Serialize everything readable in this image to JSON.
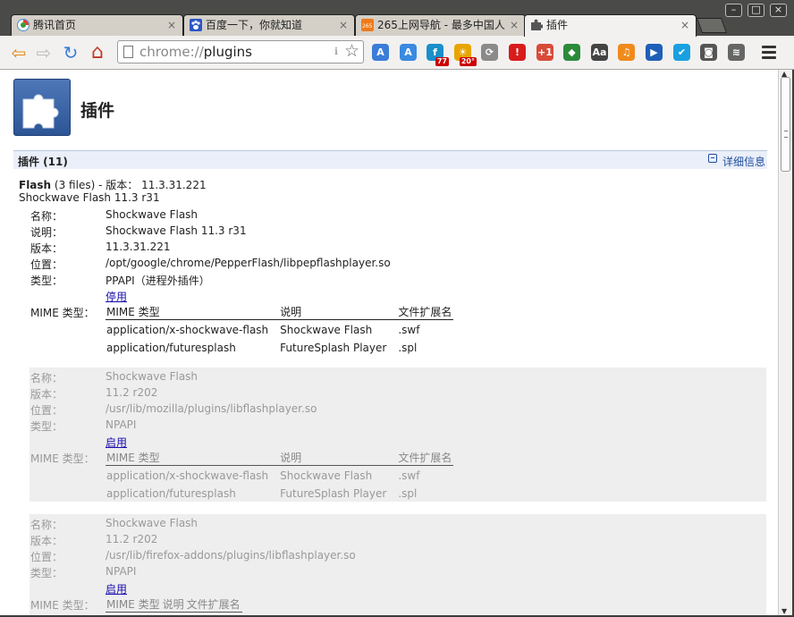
{
  "tabs": [
    {
      "title": "腾讯首页",
      "icon": "tencent-icon"
    },
    {
      "title": "百度一下，你就知道",
      "icon": "baidu-paw-icon"
    },
    {
      "title": "265上网导航 - 最多中国人",
      "icon": "265-nav-icon"
    },
    {
      "title": "插件",
      "icon": "puzzle-icon",
      "active": true
    }
  ],
  "tab_close": "×",
  "window_controls": {
    "minimize": "–",
    "maximize": "□",
    "close": "×"
  },
  "toolbar": {
    "back": "⇦",
    "forward": "⇨",
    "reload": "↻",
    "home": "⌂",
    "url_scheme": "chrome://",
    "url_path": "plugins",
    "mic": "ℹ",
    "star": "☆",
    "extensions": [
      {
        "name": "translate-icon",
        "label": "A",
        "color": "#3a7dd8"
      },
      {
        "name": "translate-alt-icon",
        "label": "A",
        "color": "#3a8ae0"
      },
      {
        "name": "fanfou-icon",
        "label": "f",
        "color": "#1b8fc9",
        "badge": "77"
      },
      {
        "name": "weather-icon",
        "label": "☀",
        "color": "#e8a400",
        "badge": "20°"
      },
      {
        "name": "sync-icon",
        "label": "⟳",
        "color": "#8a8a8a"
      },
      {
        "name": "alert-icon",
        "label": "!",
        "color": "#d81c1c"
      },
      {
        "name": "google-plus-one-icon",
        "label": "+1",
        "color": "#d84b37"
      },
      {
        "name": "feedly-icon",
        "label": "◆",
        "color": "#2b8b3b"
      },
      {
        "name": "dictionary-icon",
        "label": "Aa",
        "color": "#444444"
      },
      {
        "name": "music-icon",
        "label": "♫",
        "color": "#f08a1c"
      },
      {
        "name": "send-to-phone-icon",
        "label": "▶",
        "color": "#1f5fb8"
      },
      {
        "name": "message-icon",
        "label": "✔",
        "color": "#1aa0e0"
      },
      {
        "name": "evernote-icon",
        "label": "◙",
        "color": "#555555"
      },
      {
        "name": "wifi-icon",
        "label": "≋",
        "color": "#666666"
      }
    ]
  },
  "page": {
    "title": "插件",
    "section_title": "插件 (11)",
    "details_link": "详细信息"
  },
  "plugin": {
    "name": "Flash",
    "files": "(3 files) - 版本：",
    "version": "11.3.31.221",
    "subtitle": "Shockwave Flash 11.3 r31"
  },
  "labels": {
    "name": "名称：",
    "description": "说明：",
    "version": "版本：",
    "location": "位置：",
    "type": "类型：",
    "mime": "MIME 类型："
  },
  "mime_headers": [
    "MIME 类型",
    "说明",
    "文件扩展名"
  ],
  "entries": [
    {
      "enabled": true,
      "name": "Shockwave Flash",
      "description": "Shockwave Flash 11.3 r31",
      "version": "11.3.31.221",
      "location": "/opt/google/chrome/PepperFlash/libpepflashplayer.so",
      "type": "PPAPI（进程外插件）",
      "toggle": "停用",
      "mime": [
        [
          "application/x-shockwave-flash",
          "Shockwave Flash",
          ".swf"
        ],
        [
          "application/futuresplash",
          "FutureSplash Player",
          ".spl"
        ]
      ]
    },
    {
      "enabled": false,
      "name": "Shockwave Flash",
      "version": "11.2 r202",
      "location": "/usr/lib/mozilla/plugins/libflashplayer.so",
      "type": "NPAPI",
      "toggle": "启用",
      "mime": [
        [
          "application/x-shockwave-flash",
          "Shockwave Flash",
          ".swf"
        ],
        [
          "application/futuresplash",
          "FutureSplash Player",
          ".spl"
        ]
      ]
    },
    {
      "enabled": false,
      "name": "Shockwave Flash",
      "version": "11.2 r202",
      "location": "/usr/lib/firefox-addons/plugins/libflashplayer.so",
      "type": "NPAPI",
      "toggle": "启用",
      "mime": []
    }
  ]
}
